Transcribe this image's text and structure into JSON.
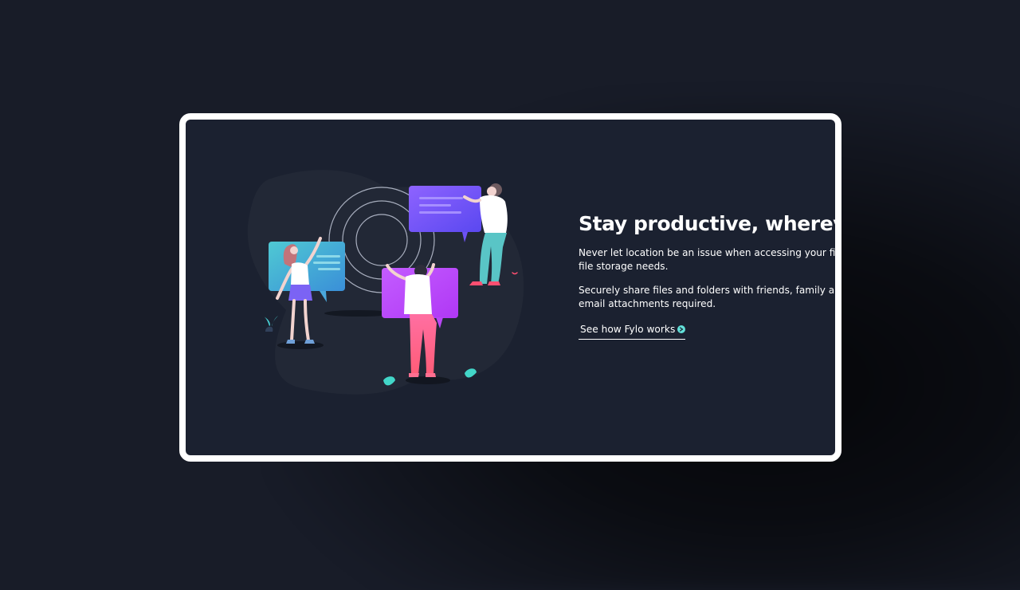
{
  "section": {
    "headline": "Stay productive, whereve",
    "paragraph_1": "Never let location be an issue when accessing your files. Fy",
    "paragraph_1_line2": "file storage needs.",
    "paragraph_2": "Securely share files and folders with friends, family and co",
    "paragraph_2_line2": "email attachments required.",
    "link_label": "See how Fylo works"
  },
  "icons": {
    "link_arrow": "arrow-right-circle-icon",
    "illustration": "productivity-illustration"
  },
  "colors": {
    "page_background": "#181c28",
    "card_background": "#1b2130",
    "card_border": "#ffffff",
    "text": "#ffffff",
    "accent_cyan": "#62e0d9",
    "accent_purple": "#6f53ff",
    "accent_magenta": "#ff4bff",
    "accent_pink": "#ff6f91"
  }
}
